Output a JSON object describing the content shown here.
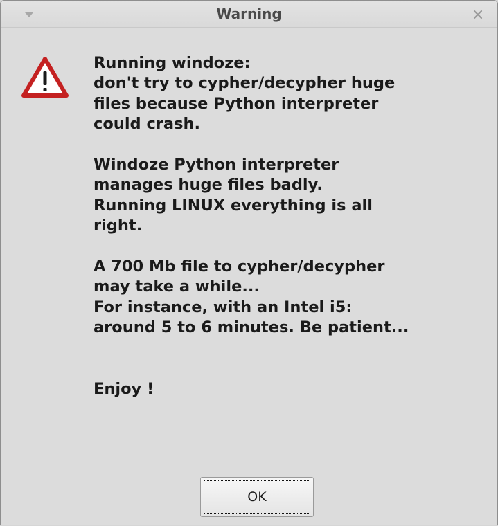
{
  "window": {
    "title": "Warning",
    "menu_icon": "chevron-down-icon",
    "close_icon": "close-icon"
  },
  "dialog": {
    "icon": "warning-triangle-icon",
    "icon_colors": {
      "border": "#c42121",
      "fill": "#ffffff",
      "mark": "#1a1a1a"
    },
    "message_lines": [
      "Running windoze:",
      "don't try to cypher/decypher huge",
      "files because Python interpreter",
      "could crash.",
      "",
      "Windoze Python interpreter",
      "manages huge files badly.",
      "Running LINUX everything is all",
      "right.",
      "",
      "A 700 Mb file to cypher/decypher",
      "may take a while...",
      "For instance, with an Intel i5:",
      "around 5 to 6 minutes. Be patient...",
      "",
      "",
      "Enjoy !"
    ]
  },
  "buttons": {
    "ok": {
      "mnemonic": "O",
      "rest": "K"
    }
  }
}
